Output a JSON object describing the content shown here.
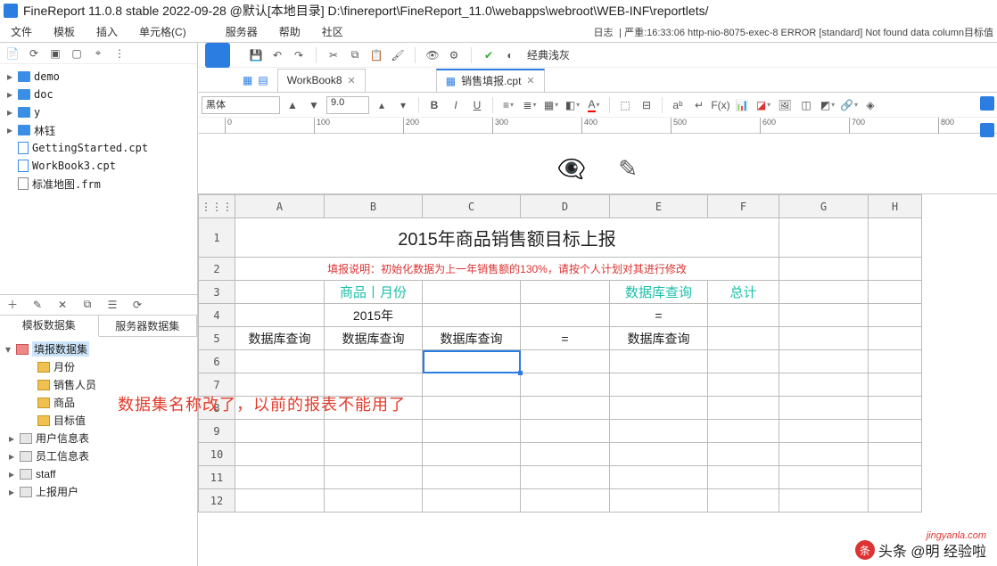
{
  "window": {
    "title": "FineReport 11.0.8 stable 2022-09-28 @默认[本地目录]   D:\\finereport\\FineReport_11.0\\webapps\\webroot\\WEB-INF\\reportlets/"
  },
  "menu": {
    "items": [
      "文件",
      "模板",
      "插入",
      "单元格(C)",
      "服务器",
      "帮助",
      "社区"
    ],
    "log_label": "日志",
    "log_text": "| 严重:16:33:06 http-nio-8075-exec-8 ERROR [standard] Not found data column目标值"
  },
  "file_tree": {
    "items": [
      {
        "type": "folder",
        "label": "demo",
        "tw": "▸"
      },
      {
        "type": "folder",
        "label": "doc",
        "tw": "▸"
      },
      {
        "type": "folder",
        "label": "y",
        "tw": "▸"
      },
      {
        "type": "folder",
        "label": "林钰",
        "tw": "▸"
      },
      {
        "type": "file",
        "label": "GettingStarted.cpt"
      },
      {
        "type": "file",
        "label": "WorkBook3.cpt"
      },
      {
        "type": "frm",
        "label": "标准地图.frm"
      }
    ]
  },
  "ds_tabs": {
    "a": "模板数据集",
    "b": "服务器数据集"
  },
  "ds_tree": {
    "root": "填报数据集",
    "children": [
      "月份",
      "销售人员",
      "商品",
      "目标值"
    ],
    "tables": [
      "用户信息表",
      "员工信息表",
      "staff",
      "上报用户"
    ]
  },
  "red_note": "数据集名称改了，以前的报表不能用了",
  "doc_tabs": {
    "tab1": "WorkBook8",
    "tab2": "销售填报.cpt"
  },
  "theme_label": "经典浅灰",
  "format": {
    "font": "黑体",
    "size": "9.0",
    "bold": "B",
    "italic": "I",
    "underline": "U",
    "fx": "F(x)"
  },
  "ruler_ticks": [
    "0",
    "100",
    "200",
    "300",
    "400",
    "500",
    "600",
    "700",
    "800"
  ],
  "columns": [
    "A",
    "B",
    "C",
    "D",
    "E",
    "F",
    "G",
    "H"
  ],
  "rows": [
    "1",
    "2",
    "3",
    "4",
    "5",
    "6",
    "7",
    "8",
    "9",
    "10",
    "11",
    "12"
  ],
  "cells": {
    "title": "2015年商品销售额目标上报",
    "note": "填报说明：初始化数据为上一年销售额的130%，请按个人计划对其进行修改",
    "b3": "商品丨月份",
    "e3": "数据库查询",
    "f3": "总计",
    "b4": "2015年",
    "e4": "=",
    "a5": "数据库查询",
    "b5": "数据库查询",
    "c5": "数据库查询",
    "d5": "=",
    "e5": "数据库查询"
  },
  "watermark": {
    "line1": "头条 @明  经验啦  ",
    "line2": "jingyanla.com"
  }
}
